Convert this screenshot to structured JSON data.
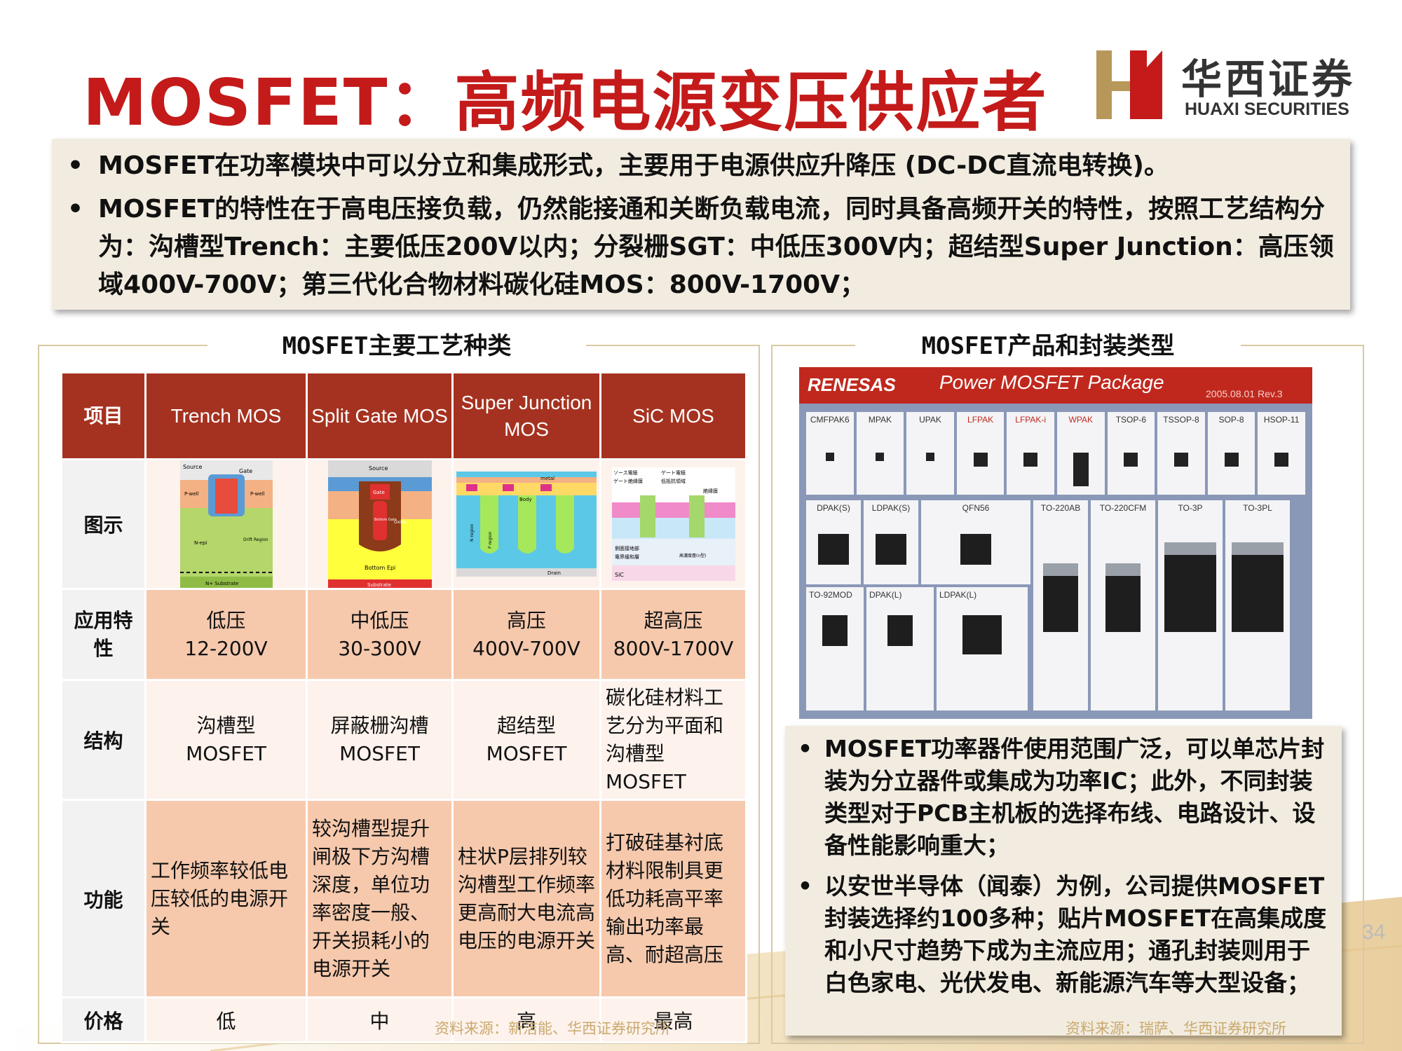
{
  "title": "MOSFET：高频电源变压供应者",
  "logo": {
    "cn": "华西证券",
    "en": "HUAXI SECURITIES"
  },
  "intro": [
    "MOSFET在功率模块中可以分立和集成形式，主要用于电源供应升降压 (DC-DC直流电转换)。",
    "MOSFET的特性在于高电压接负载，仍然能接通和关断负载电流，同时具备高频开关的特性，按照工艺结构分为：沟槽型Trench：主要低压200V以内；分裂栅SGT：中低压300V内；超结型Super Junction：高压领域400V-700V；第三代化合物材料碳化硅MOS：800V-1700V；"
  ],
  "left_panel": {
    "title": "MOSFET主要工艺种类",
    "headers": [
      "项目",
      "Trench MOS",
      "Split Gate MOS",
      "Super Junction MOS",
      "SiC MOS"
    ],
    "row_labels": {
      "diagram": "图示",
      "application": "应用特性",
      "structure": "结构",
      "function": "功能",
      "price": "价格"
    },
    "application": [
      "低压\n12-200V",
      "中低压\n30-300V",
      "高压\n400V-700V",
      "超高压\n800V-1700V"
    ],
    "structure": [
      "沟槽型\nMOSFET",
      "屏蔽栅沟槽\nMOSFET",
      "超结型\nMOSFET",
      "碳化硅材料工艺分为平面和沟槽型MOSFET"
    ],
    "function": [
      "工作频率较低电压较低的电源开关",
      "较沟槽型提升闸极下方沟槽深度，单位功率密度一般、开关损耗小的电源开关",
      "柱状P层排列较沟槽型工作频率更高耐大电流高电压的电源开关",
      "打破硅基衬底材料限制具更低功耗高平率输出功率最高、耐超高压"
    ],
    "price": [
      "低",
      "中",
      "高",
      "最高"
    ],
    "source": "资料来源：新洁能、华西证券研究所",
    "diagrams": {
      "trench": [
        "Source",
        "Gate",
        "P-well",
        "P-well",
        "N-epi",
        "Drift Region",
        "N+ Substrate"
      ],
      "split": [
        "Source",
        "Gate",
        "Oxide",
        "Bottom Gate",
        "Bottom Epi",
        "Substrate"
      ],
      "super": [
        "metal",
        "Body",
        "N region",
        "P region",
        "Drain"
      ],
      "sic": [
        "ソース電極",
        "ゲート電極",
        "ゲート絶縁膜",
        "低抵抗領域",
        "絶縁膜",
        "側面接地部",
        "電界緩和層",
        "高濃度層(n型)",
        "SiC"
      ]
    }
  },
  "right_panel": {
    "title": "MOSFET产品和封装类型",
    "photo": {
      "brand": "RENESAS",
      "heading": "Power MOSFET Package",
      "rev": "2005.08.01 Rev.3",
      "row1": [
        "CMFPAK6",
        "MPAK",
        "UPAK",
        "LFPAK",
        "LFPAK-i",
        "WPAK",
        "TSOP-6",
        "TSSOP-8",
        "SOP-8",
        "HSOP-11"
      ],
      "row2": [
        "DPAK(S)",
        "LDPAK(S)",
        "QFN56",
        "TO-220AB",
        "TO-220CFM",
        "TO-3P",
        "TO-3PL"
      ],
      "row3": [
        "TO-92MOD",
        "DPAK(L)",
        "LDPAK(L)"
      ]
    },
    "notes": [
      "MOSFET功率器件使用范围广泛，可以单芯片封装为分立器件或集成为功率IC；此外，不同封装类型对于PCB主机板的选择布线、电路设计、设备性能影响重大；",
      "以安世半导体（闻泰）为例，公司提供MOSFET封装选择约100多种；贴片MOSFET在高集成度和小尺寸趋势下成为主流应用；通孔封装则用于白色家电、光伏发电、新能源汽车等大型设备；"
    ],
    "source": "资料来源：瑞萨、华西证券研究所"
  },
  "page_number": "34",
  "colors": {
    "title": "#c41a1a",
    "header_bg": "#a53220",
    "pink": "#f6c9ad",
    "panel_bg": "#f2ece0"
  }
}
